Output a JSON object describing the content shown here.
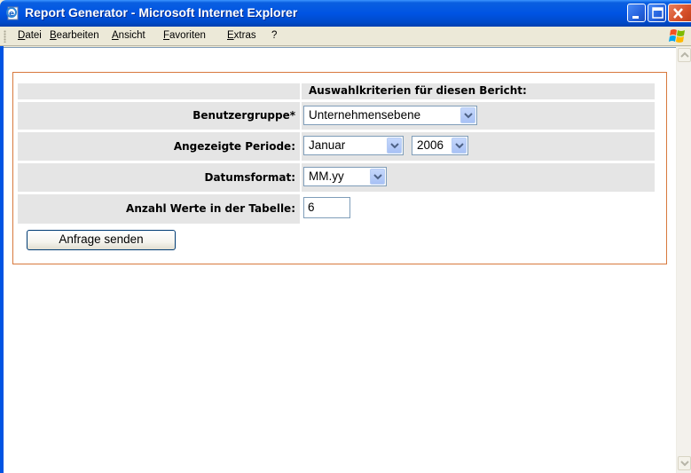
{
  "window": {
    "title": "Report Generator - Microsoft Internet Explorer",
    "icon": "ie-page-icon",
    "buttons": [
      "minimize",
      "maximize",
      "close"
    ]
  },
  "menubar": {
    "items": [
      "Datei",
      "Bearbeiten",
      "Ansicht",
      "Favoriten",
      "Extras",
      "?"
    ]
  },
  "form": {
    "header": "Auswahlkriterien für diesen Bericht:",
    "rows": [
      {
        "label": "Benutzergruppe*",
        "selects": [
          {
            "value": "Unternehmensebene"
          }
        ]
      },
      {
        "label": "Angezeigte Periode:",
        "selects": [
          {
            "value": "Januar"
          },
          {
            "value": "2006"
          }
        ]
      },
      {
        "label": "Datumsformat:",
        "selects": [
          {
            "value": "MM.yy"
          }
        ]
      },
      {
        "label": "Anzahl Werte in der Tabelle:",
        "input_value": "6"
      }
    ],
    "submit_label": "Anfrage senden"
  },
  "colors": {
    "titlebar": "#0054e3",
    "panel_border": "#d8793d",
    "row_background": "#e5e5e5"
  }
}
